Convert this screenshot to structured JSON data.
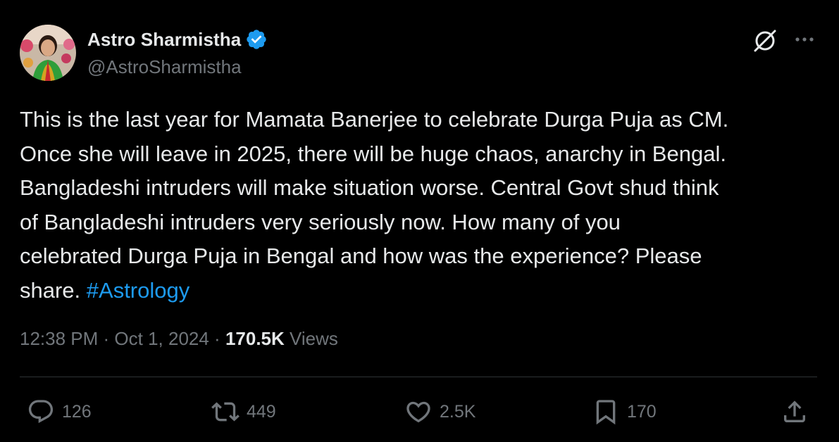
{
  "author": {
    "display_name": "Astro Sharmistha",
    "handle": "@AstroSharmistha",
    "verified": true,
    "verified_color": "#1d9bf0"
  },
  "tweet": {
    "text": "This is the last year for Mamata Banerjee to celebrate Durga Puja as CM.\nOnce she will leave in 2025, there will be huge chaos, anarchy in Bengal.\nBangladeshi intruders will make situation worse. Central Govt shud think\nof Bangladeshi intruders very seriously now. How many of you\ncelebrated Durga Puja in Bengal and how was the experience? Please\nshare. ",
    "hashtag": "#Astrology",
    "hashtag_color": "#1d9bf0"
  },
  "meta": {
    "time": "12:38 PM",
    "separator": " · ",
    "date": "Oct 1, 2024",
    "views_count": "170.5K",
    "views_label": " Views"
  },
  "actions": {
    "replies": "126",
    "reposts": "449",
    "likes": "2.5K",
    "bookmarks": "170"
  },
  "icons": {
    "grok": "grok-icon",
    "more": "more-icon",
    "reply": "reply-icon",
    "repost": "repost-icon",
    "like": "heart-icon",
    "bookmark": "bookmark-icon",
    "share": "share-icon"
  },
  "colors": {
    "background": "#000000",
    "text_primary": "#e7e9ea",
    "text_secondary": "#71767b",
    "divider": "#2f3336"
  }
}
